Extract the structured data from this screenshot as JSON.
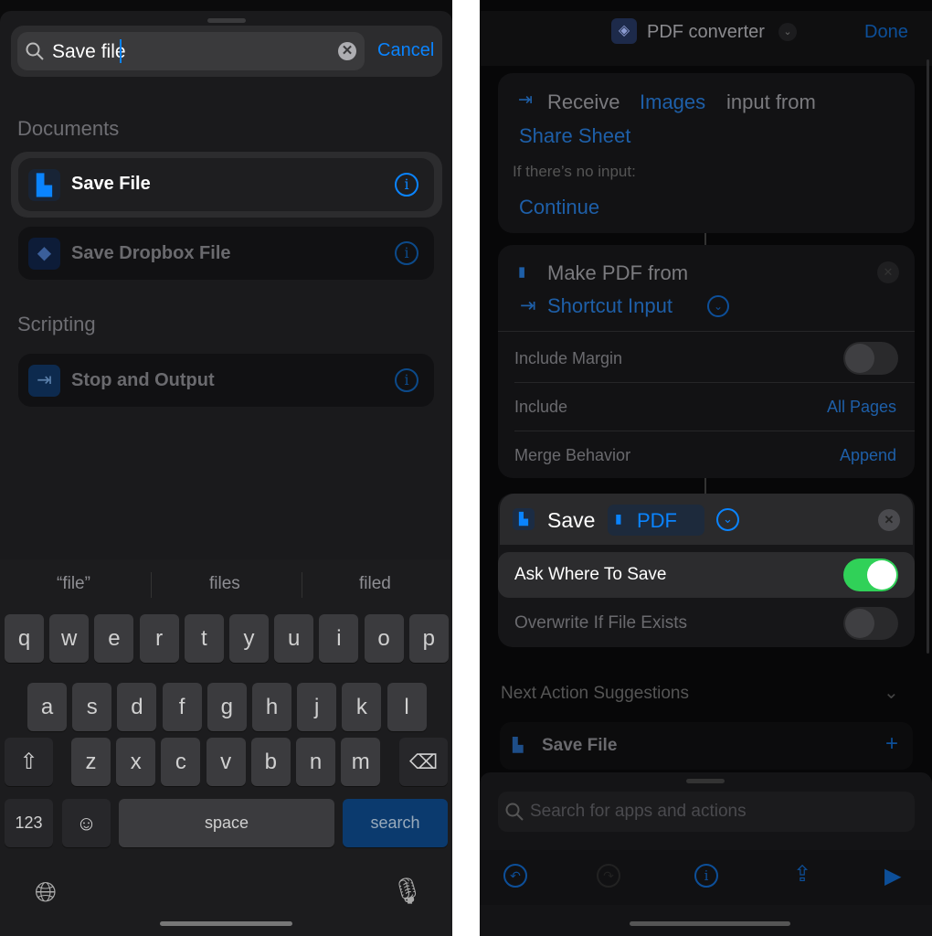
{
  "left": {
    "search": {
      "value": "Save file",
      "cancel": "Cancel"
    },
    "sections": [
      {
        "title": "Documents",
        "items": [
          {
            "label": "Save File",
            "icon": "save-file-icon"
          },
          {
            "label": "Save Dropbox File",
            "icon": "dropbox-icon"
          }
        ]
      },
      {
        "title": "Scripting",
        "items": [
          {
            "label": "Stop and Output",
            "icon": "stop-output-icon"
          }
        ]
      }
    ],
    "keyboard": {
      "suggestions": [
        "“file”",
        "files",
        "filed"
      ],
      "row1": [
        "q",
        "w",
        "e",
        "r",
        "t",
        "y",
        "u",
        "i",
        "o",
        "p"
      ],
      "row2": [
        "a",
        "s",
        "d",
        "f",
        "g",
        "h",
        "j",
        "k",
        "l"
      ],
      "row3": [
        "z",
        "x",
        "c",
        "v",
        "b",
        "n",
        "m"
      ],
      "numbers": "123",
      "space": "space",
      "search": "search"
    }
  },
  "right": {
    "header": {
      "title": "PDF converter",
      "done": "Done"
    },
    "receive": {
      "verb": "Receive",
      "type": "Images",
      "mid": "input from",
      "source": "Share Sheet",
      "no_input": "If there’s no input:",
      "fallback": "Continue"
    },
    "make_pdf": {
      "title": "Make PDF from",
      "input": "Shortcut Input",
      "rows": [
        {
          "label": "Include Margin",
          "toggle": false
        },
        {
          "label": "Include",
          "value": "All Pages"
        },
        {
          "label": "Merge Behavior",
          "value": "Append"
        }
      ]
    },
    "save": {
      "verb": "Save",
      "param": "PDF",
      "rows": [
        {
          "label": "Ask Where To Save",
          "toggle": true
        },
        {
          "label": "Overwrite If File Exists",
          "toggle": false
        }
      ]
    },
    "suggestions": {
      "title": "Next Action Suggestions",
      "items": [
        {
          "label": "Save File"
        }
      ]
    },
    "search_placeholder": "Search for apps and actions",
    "colors": {
      "accent": "#0a84ff",
      "toggle_on": "#30d158"
    }
  }
}
